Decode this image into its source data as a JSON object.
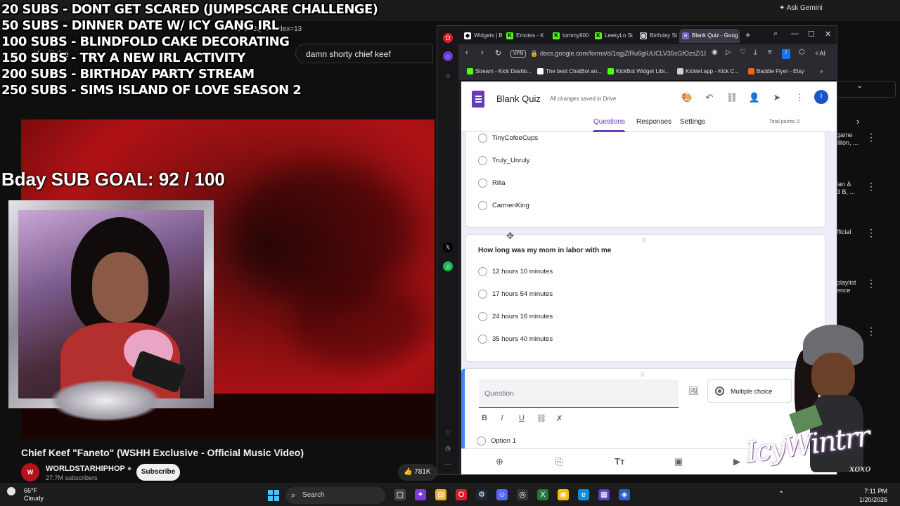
{
  "overlay": {
    "goals": [
      "20 SUBS - DONT GET SCARED (JUMPSCARE CHALLENGE)",
      "50 SUBS - DINNER DATE W/ ICY GANG IRL",
      "100 SUBS - BLINDFOLD CAKE DECORATING",
      "150 SUBS - TRY A NEW IRL ACTIVITY",
      "200 SUBS - BIRTHDAY PARTY STREAM",
      "250 SUBS - SIMS ISLAND OF LOVE SEASON 2"
    ],
    "bday_goal": "Bday SUB GOAL: 92 / 100",
    "signature": "IcyWintrr",
    "signature_small": "xoxo"
  },
  "youtube": {
    "url_fragment": "vGJdZ2Q-o&index=13",
    "logo": "YouTube",
    "search_value": "damn shorty chief keef",
    "video_title": "Chief Keef \"Faneto\" (WSHH Exclusive - Official Music Video)",
    "channel": "WORLDSTARHIPHOP",
    "subscribers": "27.7M subscribers",
    "subscribe_label": "Subscribe",
    "likes": "781K",
    "ask_gemini": "Ask Gemini",
    "sidebar": [
      {
        "line1": "game",
        "line2": "illion, ..."
      },
      {
        "line1": "lan &",
        "line2": "3 B, ..."
      },
      {
        "line1": "fficial",
        "line2": ""
      },
      {
        "line1": "playlist",
        "line2": "ence"
      }
    ]
  },
  "browser": {
    "tabs": [
      {
        "label": "Widgets | B",
        "icon": "widgets-icon"
      },
      {
        "label": "Emotes - K",
        "icon": "kick-icon"
      },
      {
        "label": "tommy900",
        "icon": "kick-icon"
      },
      {
        "label": "LeekyLo St",
        "icon": "kick-icon"
      },
      {
        "label": "Birthday St",
        "icon": "globe-icon"
      },
      {
        "label": "Blank Quiz - Goog",
        "icon": "forms-icon"
      }
    ],
    "url": "docs.google.com/forms/d/1ogjZlRu6giUUCLV35sGfOzsZl1B5",
    "vpn_label": "VPN",
    "ai_label": "AI",
    "bookmarks": [
      {
        "label": "Stream - Kick Dashb...",
        "color": "#53fc18"
      },
      {
        "label": "The best ChatBot an...",
        "color": "#ffffff"
      },
      {
        "label": "KickBot Widget Libr...",
        "color": "#53fc18"
      },
      {
        "label": "Kicklet.app - Kick C...",
        "color": "#cfcfcf"
      },
      {
        "label": "Baddie Flyer - Etsy",
        "color": "#f1641e"
      }
    ]
  },
  "form": {
    "title": "Blank Quiz",
    "saved_status": "All changes saved in Drive",
    "tabs": [
      "Questions",
      "Responses",
      "Settings"
    ],
    "total_points": "Total points: 0",
    "accent": "#673ab7",
    "prev_options": [
      "TinyCofeeCups",
      "Truly_Unruly",
      "Rilla",
      "CarmenKing"
    ],
    "question": {
      "title": "How long was my mom in labor with me",
      "options": [
        "12 hours 10 minutes",
        "17 hours 54 minutes",
        "24 hours 16 minutes",
        "35 hours 40 minutes"
      ]
    },
    "new_question": {
      "placeholder": "Question",
      "type": "Multiple choice",
      "option1": "Option 1"
    }
  },
  "taskbar": {
    "temp": "66°F",
    "condition": "Cloudy",
    "search_label": "Search",
    "time": "7:11 PM",
    "date": "1/20/2026"
  }
}
